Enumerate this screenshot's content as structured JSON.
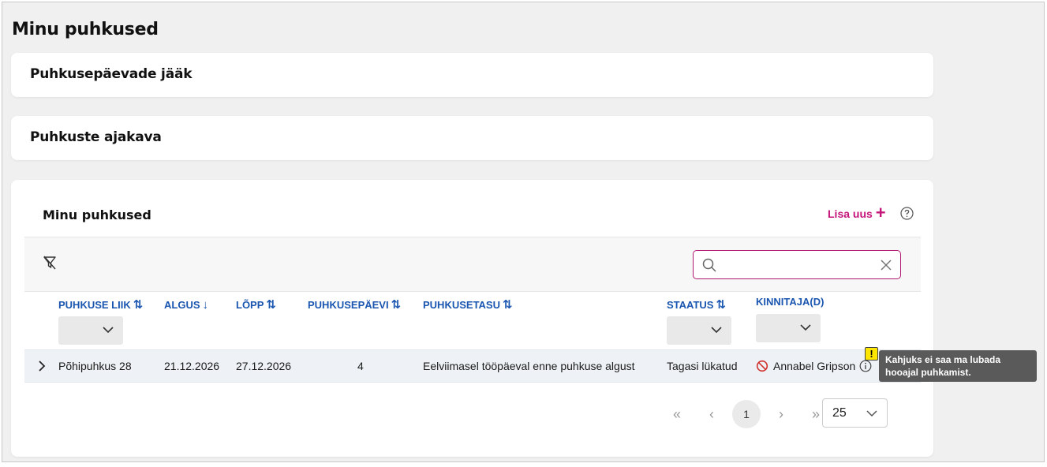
{
  "page": {
    "title": "Minu puhkused"
  },
  "cards": {
    "balance_title": "Puhkusepäevade jääk",
    "schedule_title": "Puhkuste ajakava"
  },
  "section": {
    "title": "Minu puhkused",
    "add_label": "Lisa uus",
    "add_icon": "plus-icon",
    "help_icon": "help-circle-icon",
    "accent_color": "#c4157a"
  },
  "toolbar": {
    "filter_icon": "filter-off-icon",
    "search": {
      "value": "",
      "placeholder": ""
    }
  },
  "table": {
    "columns": [
      {
        "label": "PUHKUSE LIIK",
        "sort": "sort-both-icon",
        "filter": true
      },
      {
        "label": "ALGUS",
        "sort": "sort-desc-icon",
        "filter": false
      },
      {
        "label": "LÕPP",
        "sort": "sort-both-icon",
        "filter": false
      },
      {
        "label": "PUHKUSEPÄEVI",
        "sort": "sort-both-icon",
        "filter": false
      },
      {
        "label": "PUHKUSETASU",
        "sort": "sort-both-icon",
        "filter": false
      },
      {
        "label": "STAATUS",
        "sort": "sort-both-icon",
        "filter": true
      },
      {
        "label": "KINNITAJA(D)",
        "sort": "",
        "filter": true
      }
    ],
    "rows": [
      {
        "type": "Põhipuhkus 28",
        "start": "21.12.2026",
        "end": "27.12.2026",
        "days": "4",
        "pay": "Eelviimasel tööpäeval enne puhkuse algust",
        "status": "Tagasi lükatud",
        "approver": "Annabel Gripson"
      }
    ]
  },
  "pagination": {
    "first": "«",
    "prev": "‹",
    "current": "1",
    "next": "›",
    "last": "»",
    "page_size": "25"
  },
  "tooltip": {
    "badge": "!",
    "text": "Kahjuks ei saa ma lubada hooajal puhkamist."
  }
}
